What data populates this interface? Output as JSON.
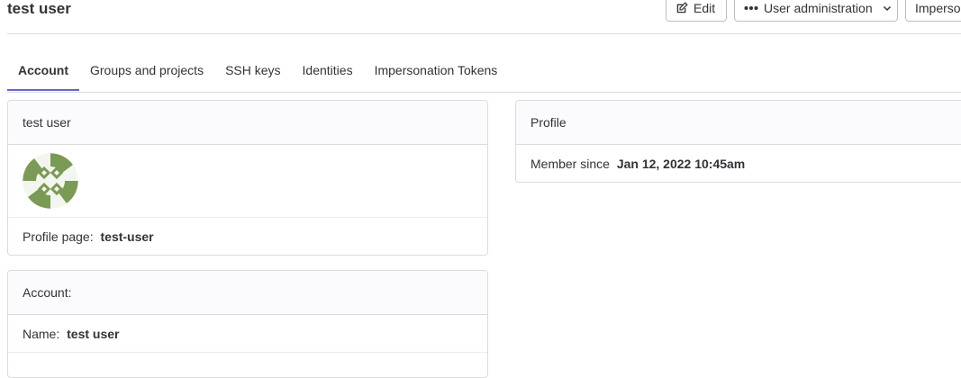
{
  "header": {
    "title": "test user",
    "edit_label": "Edit",
    "admin_label": "User administration",
    "impersonate_label": "Imperso"
  },
  "tabs": [
    {
      "label": "Account",
      "active": true
    },
    {
      "label": "Groups and projects",
      "active": false
    },
    {
      "label": "SSH keys",
      "active": false
    },
    {
      "label": "Identities",
      "active": false
    },
    {
      "label": "Impersonation Tokens",
      "active": false
    }
  ],
  "profile_card": {
    "title": "test user",
    "profile_page_label": "Profile page:",
    "profile_page_value": "test-user"
  },
  "account_card": {
    "title": "Account:",
    "name_label": "Name:",
    "name_value": "test user"
  },
  "right_card": {
    "title": "Profile",
    "member_since_label": "Member since",
    "member_since_value": "Jan 12, 2022 10:45am"
  },
  "colors": {
    "tab_active_underline": "#6666c4",
    "avatar_green": "#7a9a56"
  },
  "icons": {
    "edit": "edit-icon",
    "admin": "ellipsis-icon",
    "dropdown": "chevron-down-icon"
  }
}
